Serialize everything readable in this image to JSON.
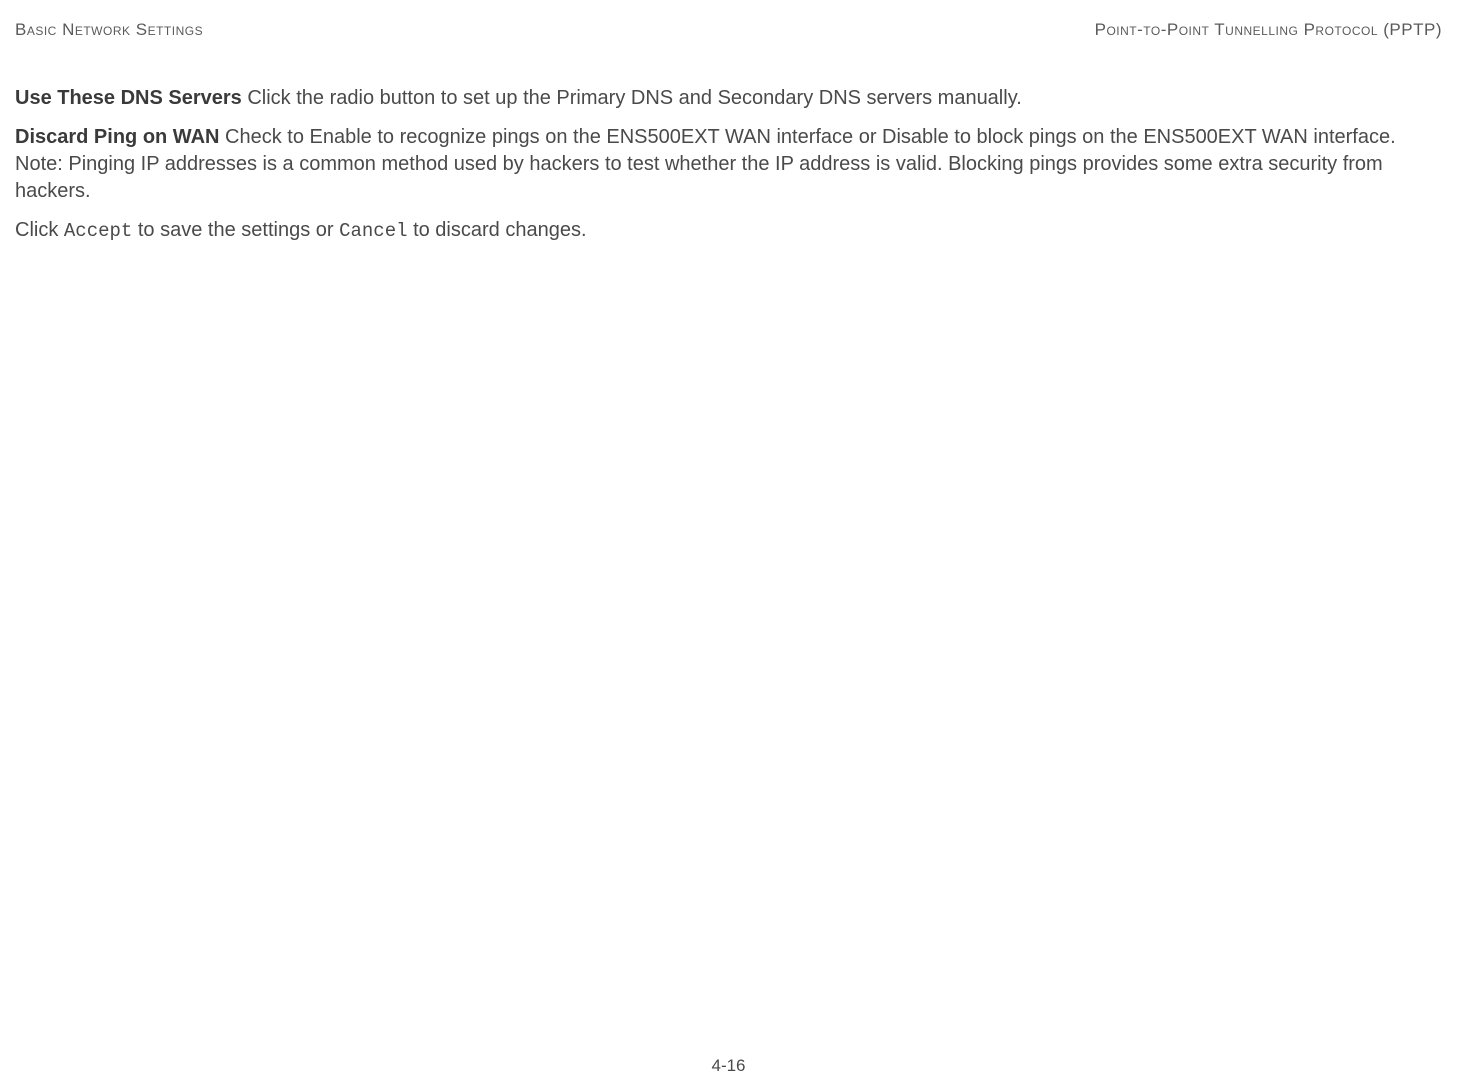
{
  "header": {
    "left": "Basic Network Settings",
    "right": "Point-to-Point Tunnelling Protocol (PPTP)"
  },
  "paragraphs": {
    "p1": {
      "label": "Use These DNS Servers",
      "text": "  Click the radio button to set up the Primary DNS and Secondary DNS servers manually."
    },
    "p2": {
      "label": "Discard Ping on WAN",
      "text": "  Check to Enable to recognize pings on the ENS500EXT WAN interface or Disable to block pings on the ENS500EXT WAN interface. Note: Pinging IP addresses is a common method used by hackers to test whether the IP address is valid. Blocking pings provides some extra security from hackers."
    },
    "p3": {
      "pre": "Click ",
      "mono1": "Accept",
      "mid": " to save the settings or ",
      "mono2": "Cancel",
      "post": " to discard changes."
    }
  },
  "footer": {
    "page": "4-16"
  }
}
